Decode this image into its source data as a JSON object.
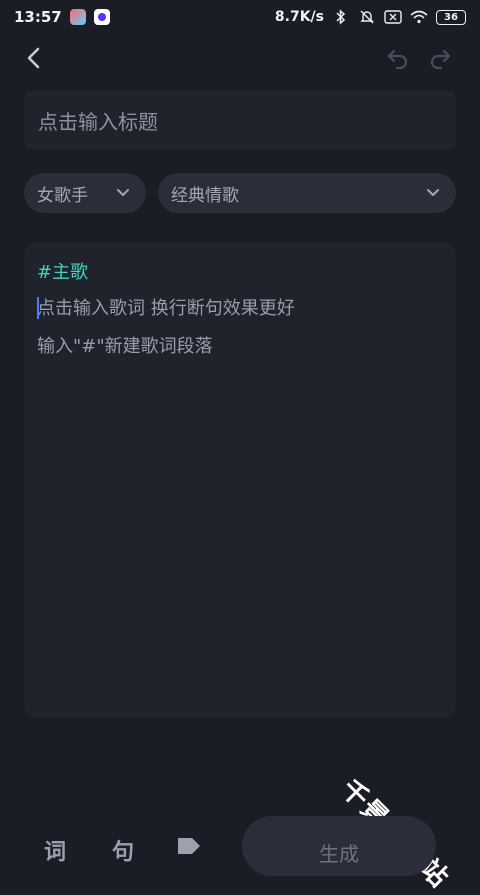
{
  "status_bar": {
    "time": "13:57",
    "net_speed": "8.7K/s",
    "battery": "36"
  },
  "header": {
    "back_icon": "chevron-left-icon",
    "undo_icon": "undo-icon",
    "redo_icon": "redo-icon"
  },
  "title_input": {
    "placeholder": "点击输入标题"
  },
  "selectors": {
    "singer": "女歌手",
    "style": "经典情歌"
  },
  "lyrics": {
    "section_tag": "#主歌",
    "input_hint": "点击输入歌词 换行断句效果更好",
    "paragraph_hint": "输入\"#\"新建歌词段落"
  },
  "watermark": "千景软件站",
  "bottom_bar": {
    "word_icon": "词",
    "sentence_icon": "句",
    "tag_icon": "tag-icon",
    "generate_label": "生成"
  },
  "colors": {
    "background": "#1b1d26",
    "panel": "#20222c",
    "chip": "#2b2d39",
    "accent_tag": "#3fd4c2",
    "caret": "#4e7cff"
  }
}
